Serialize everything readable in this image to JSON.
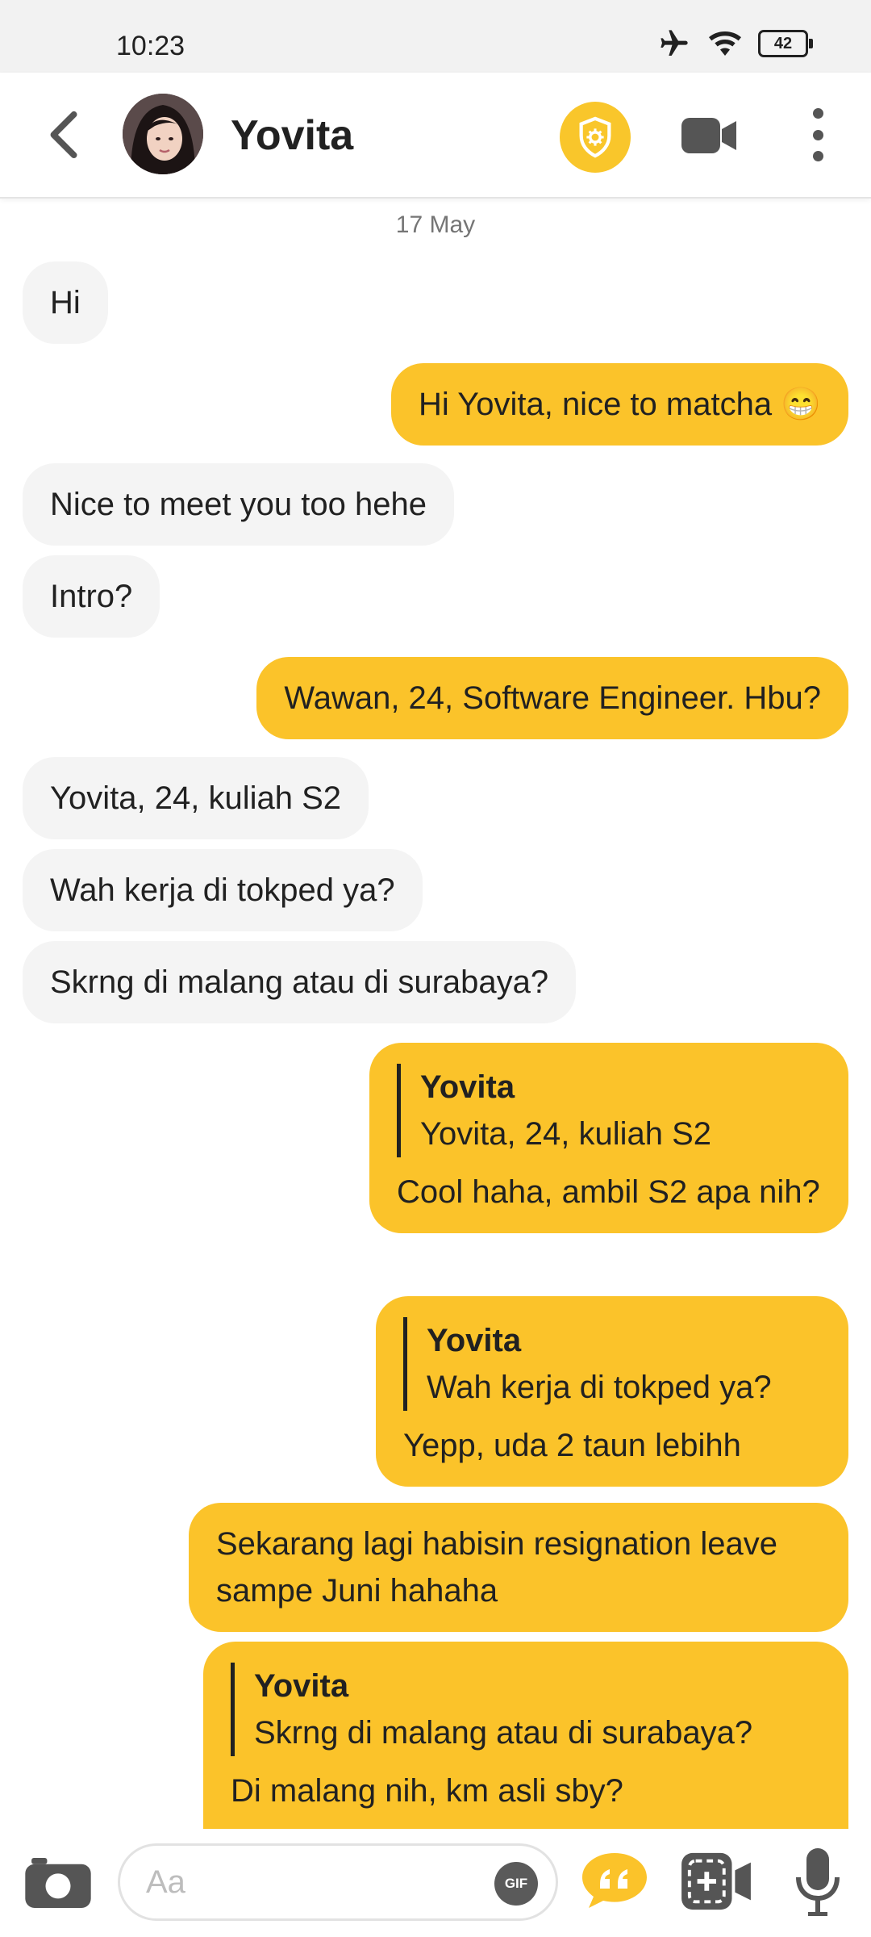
{
  "status_bar": {
    "time": "10:23",
    "battery": "42"
  },
  "header": {
    "contact_name": "Yovita"
  },
  "chat": {
    "date_label": "17 May",
    "messages": [
      {
        "dir": "in",
        "text": "Hi"
      },
      {
        "dir": "out",
        "text": "Hi Yovita, nice to matcha 😁"
      },
      {
        "dir": "in",
        "text": "Nice to meet you too hehe"
      },
      {
        "dir": "in",
        "text": "Intro?"
      },
      {
        "dir": "out",
        "text": "Wawan, 24, Software Engineer. Hbu?"
      },
      {
        "dir": "in",
        "text": "Yovita, 24, kuliah S2"
      },
      {
        "dir": "in",
        "text": "Wah kerja di tokped ya?"
      },
      {
        "dir": "in",
        "text": "Skrng di malang atau di surabaya?"
      },
      {
        "dir": "out",
        "quote_name": "Yovita",
        "quote_text": "Yovita, 24, kuliah S2",
        "text": "Cool haha, ambil S2 apa nih?"
      },
      {
        "dir": "out",
        "quote_name": "Yovita",
        "quote_text": "Wah kerja di tokped ya?",
        "text": "Yepp, uda 2 taun lebihh"
      },
      {
        "dir": "out",
        "text": "Sekarang lagi habisin resignation leave sampe Juni hahaha"
      },
      {
        "dir": "out",
        "quote_name": "Yovita",
        "quote_text": "Skrng di malang atau di surabaya?",
        "text": "Di malang nih, km asli sby?"
      }
    ]
  },
  "composer": {
    "placeholder": "Aa",
    "gif_label": "GIF"
  },
  "colors": {
    "accent": "#fbc32a",
    "incoming_bubble": "#f4f4f4"
  },
  "icons": [
    "back-arrow-icon",
    "shield-icon",
    "video-camera-icon",
    "more-vert-icon",
    "camera-icon",
    "gif-icon",
    "quote-icon",
    "spotlight-icon",
    "microphone-icon",
    "airplane-icon",
    "wifi-icon",
    "battery-icon"
  ]
}
